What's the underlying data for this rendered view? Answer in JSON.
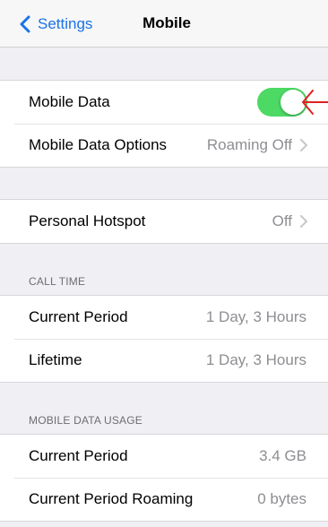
{
  "nav": {
    "back_label": "Settings",
    "title": "Mobile"
  },
  "mobile_data": {
    "label": "Mobile Data",
    "enabled": true
  },
  "mobile_data_options": {
    "label": "Mobile Data Options",
    "value": "Roaming Off"
  },
  "personal_hotspot": {
    "label": "Personal Hotspot",
    "value": "Off"
  },
  "call_time": {
    "header": "CALL TIME",
    "rows": [
      {
        "label": "Current Period",
        "value": "1 Day, 3 Hours"
      },
      {
        "label": "Lifetime",
        "value": "1 Day, 3 Hours"
      }
    ]
  },
  "mobile_data_usage": {
    "header": "MOBILE DATA USAGE",
    "rows": [
      {
        "label": "Current Period",
        "value": "3.4 GB"
      },
      {
        "label": "Current Period Roaming",
        "value": "0 bytes"
      }
    ]
  },
  "colors": {
    "accent": "#1a73e8",
    "toggle_on": "#4cd964",
    "annotation": "#e02020"
  }
}
